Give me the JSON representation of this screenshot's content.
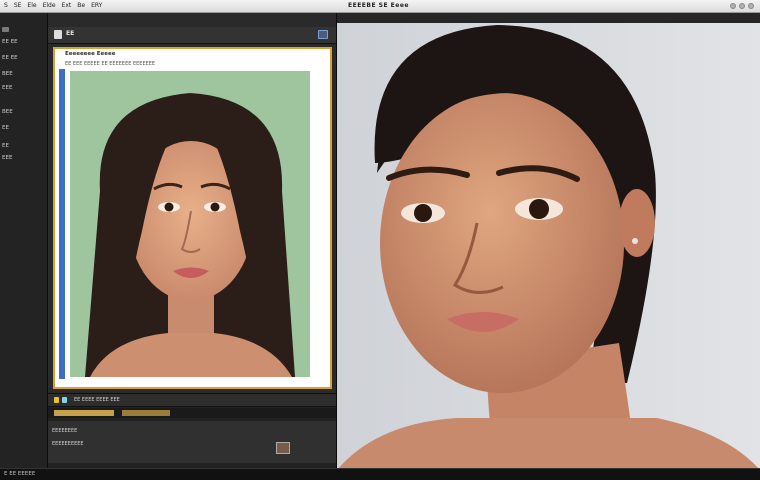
{
  "menubar": {
    "menus": [
      "S",
      "SE",
      "Ele",
      "Elde",
      "Ext",
      "Be",
      "ERY"
    ],
    "app_title": "EEEEBE SE Eeee"
  },
  "sidebar": {
    "items": [
      "EE EE",
      "EE EE",
      "BEE",
      "EEE",
      "BEE",
      "EE",
      "EE",
      "EEE"
    ]
  },
  "panel": {
    "header_label": "EE",
    "doc_title": "Eeeeeeee Eeeee",
    "doc_subtitle": "EE EEE EEEEE EE EEEEEEE EEEEEEE"
  },
  "timeline": {
    "row1": "EE EEEE EEEE EEE",
    "row2": "EEEEEEEE",
    "row3": "EEEEEEEEEE"
  },
  "statusbar": {
    "text": "E EE EEEEE"
  }
}
